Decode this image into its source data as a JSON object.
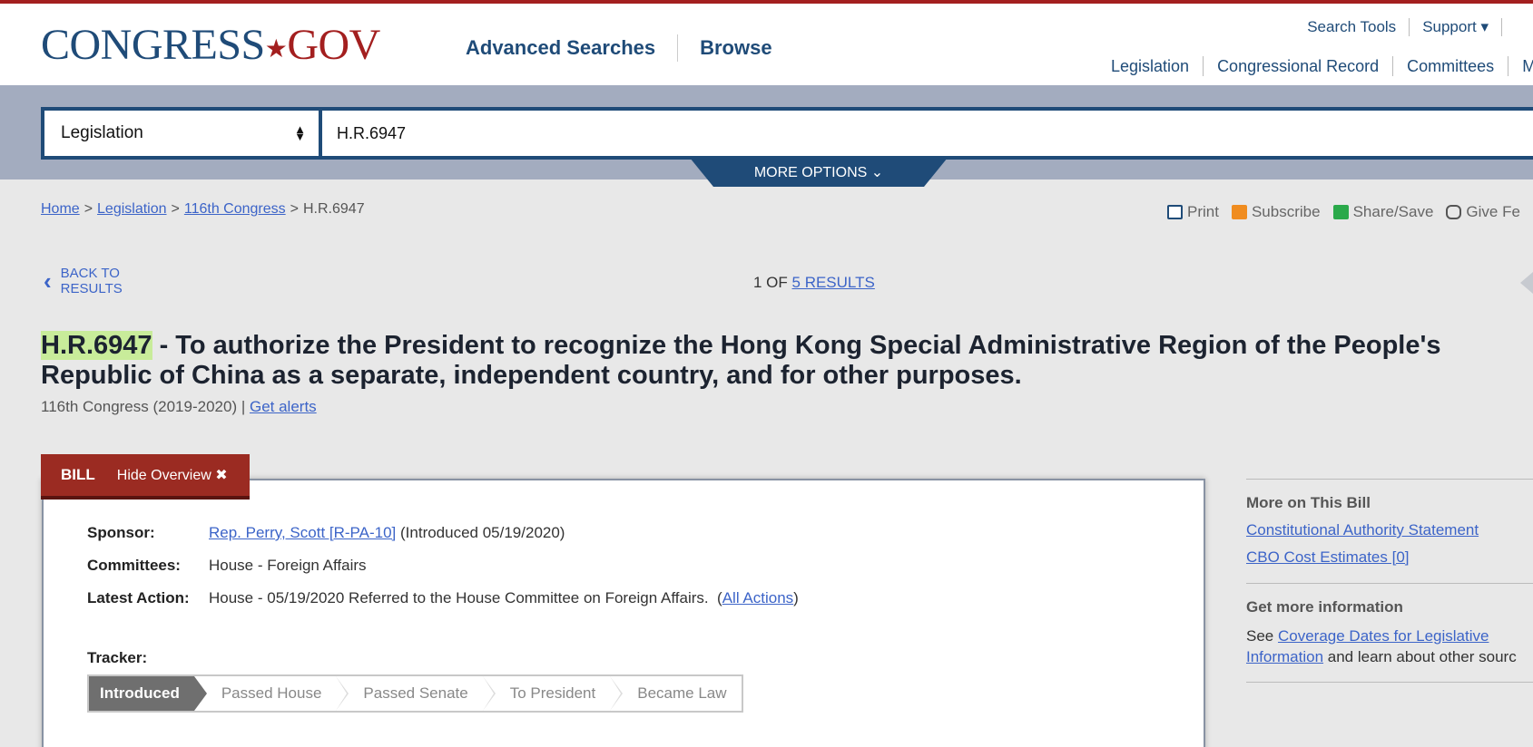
{
  "header": {
    "logo_main": "CONGRESS",
    "logo_dot": "★",
    "logo_gov": "GOV",
    "nav_primary": [
      "Advanced Searches",
      "Browse"
    ],
    "nav_util": [
      "Search Tools",
      "Support ▾"
    ],
    "nav_secondary": [
      "Legislation",
      "Congressional Record",
      "Committees",
      "M"
    ]
  },
  "search": {
    "collection": "Legislation",
    "query": "H.R.6947",
    "more_options": "MORE OPTIONS ⌄"
  },
  "breadcrumb": {
    "home": "Home",
    "legislation": "Legislation",
    "congress": "116th Congress",
    "current": "H.R.6947"
  },
  "tools": {
    "print": "Print",
    "subscribe": "Subscribe",
    "share": "Share/Save",
    "feedback": "Give Fe"
  },
  "results_nav": {
    "back_line1": "BACK TO",
    "back_line2": "RESULTS",
    "count_prefix": "1 OF ",
    "count_link": "5 RESULTS"
  },
  "bill": {
    "number": "H.R.6947",
    "title_rest": " - To authorize the President to recognize the Hong Kong Special Administrative Region of the People's Republic of China as a separate, independent country, and for other purposes.",
    "congress_text": "116th Congress (2019-2020) | ",
    "get_alerts": "Get alerts"
  },
  "overview": {
    "tab_label": "BILL",
    "hide_label": "Hide Overview ✖",
    "sponsor_label": "Sponsor:",
    "sponsor_name": "Rep. Perry, Scott [R-PA-10]",
    "sponsor_intro": " (Introduced 05/19/2020)",
    "committees_label": "Committees:",
    "committees_value": "House - Foreign Affairs",
    "latest_label": "Latest Action:",
    "latest_value": "House - 05/19/2020 Referred to the House Committee on Foreign Affairs.  (",
    "all_actions": "All Actions",
    "latest_close": ")",
    "tracker_label": "Tracker:",
    "tracker_steps": [
      "Introduced",
      "Passed House",
      "Passed Senate",
      "To President",
      "Became Law"
    ]
  },
  "sidebar": {
    "more_title": "More on This Bill",
    "links": [
      "Constitutional Authority Statement",
      "CBO Cost Estimates [0]"
    ],
    "info_title": "Get more information",
    "info_prefix": "See ",
    "info_link1": "Coverage Dates for Legislative",
    "info_link2": "Information",
    "info_suffix": " and learn about other sourc"
  }
}
